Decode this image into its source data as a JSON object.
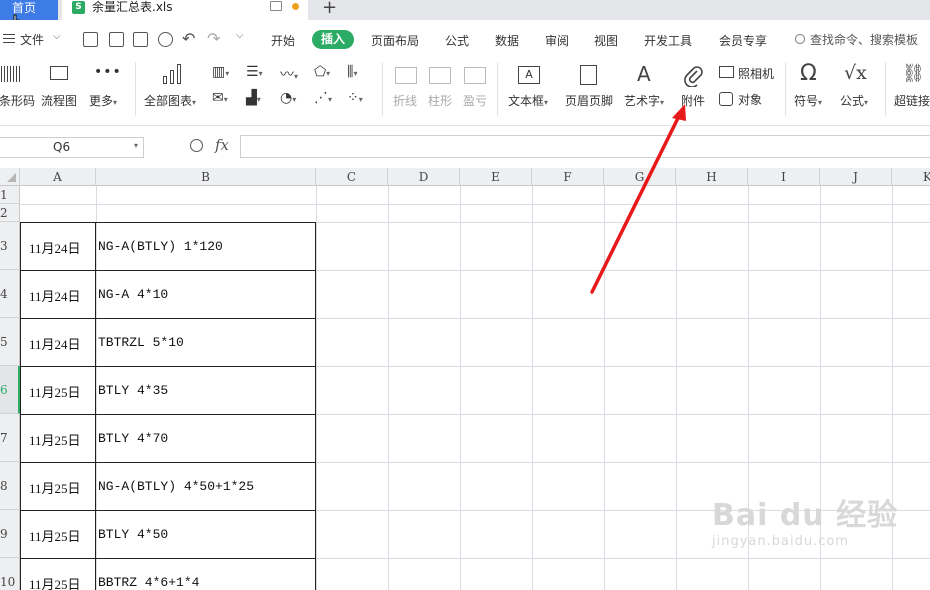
{
  "tabs": {
    "home_label": "首页",
    "file_label": "余量汇总表.xls",
    "file_icon": "S"
  },
  "menu": {
    "file_label": "文件",
    "items": [
      "开始",
      "插入",
      "页面布局",
      "公式",
      "数据",
      "审阅",
      "视图",
      "开发工具",
      "会员专享"
    ],
    "active": "插入",
    "search_placeholder": "查找命令、搜索模板"
  },
  "ribbon": {
    "barcode": "条形码",
    "flowchart": "流程图",
    "more": "更多",
    "all_charts": "全部图表",
    "line": "折线",
    "column": "柱形",
    "win_loss": "盈亏",
    "textbox": "文本框",
    "header_footer": "页眉页脚",
    "wordart": "艺术字",
    "attachment": "附件",
    "camera": "照相机",
    "object": "对象",
    "symbol": "符号",
    "formula": "公式",
    "hyperlink": "超链接"
  },
  "formula_bar": {
    "cell_ref": "Q6",
    "fx": "fx",
    "value": ""
  },
  "grid": {
    "columns": [
      "A",
      "B",
      "C",
      "D",
      "E",
      "F",
      "G",
      "H",
      "I",
      "J",
      "K"
    ],
    "row_numbers": [
      "1",
      "2",
      "3",
      "4",
      "5",
      "6",
      "7",
      "8",
      "9",
      "10"
    ],
    "active_row": "6",
    "rows": [
      {
        "date": "11月24日",
        "item": "NG-A(BTLY) 1*120"
      },
      {
        "date": "11月24日",
        "item": "NG-A 4*10"
      },
      {
        "date": "11月24日",
        "item": "TBTRZL 5*10"
      },
      {
        "date": "11月25日",
        "item": "BTLY 4*35"
      },
      {
        "date": "11月25日",
        "item": "BTLY 4*70"
      },
      {
        "date": "11月25日",
        "item": "NG-A(BTLY) 4*50+1*25"
      },
      {
        "date": "11月25日",
        "item": "BTLY 4*50"
      },
      {
        "date": "11月25日",
        "item": "BBTRZ 4*6+1*4"
      }
    ]
  },
  "watermark": {
    "brand": "Bai du 经验",
    "sub": "jingyan.baidu.com"
  },
  "colors": {
    "accent_green": "#2bab64",
    "home_tab_blue": "#3d7be7",
    "annotation_red": "#e8191a"
  }
}
